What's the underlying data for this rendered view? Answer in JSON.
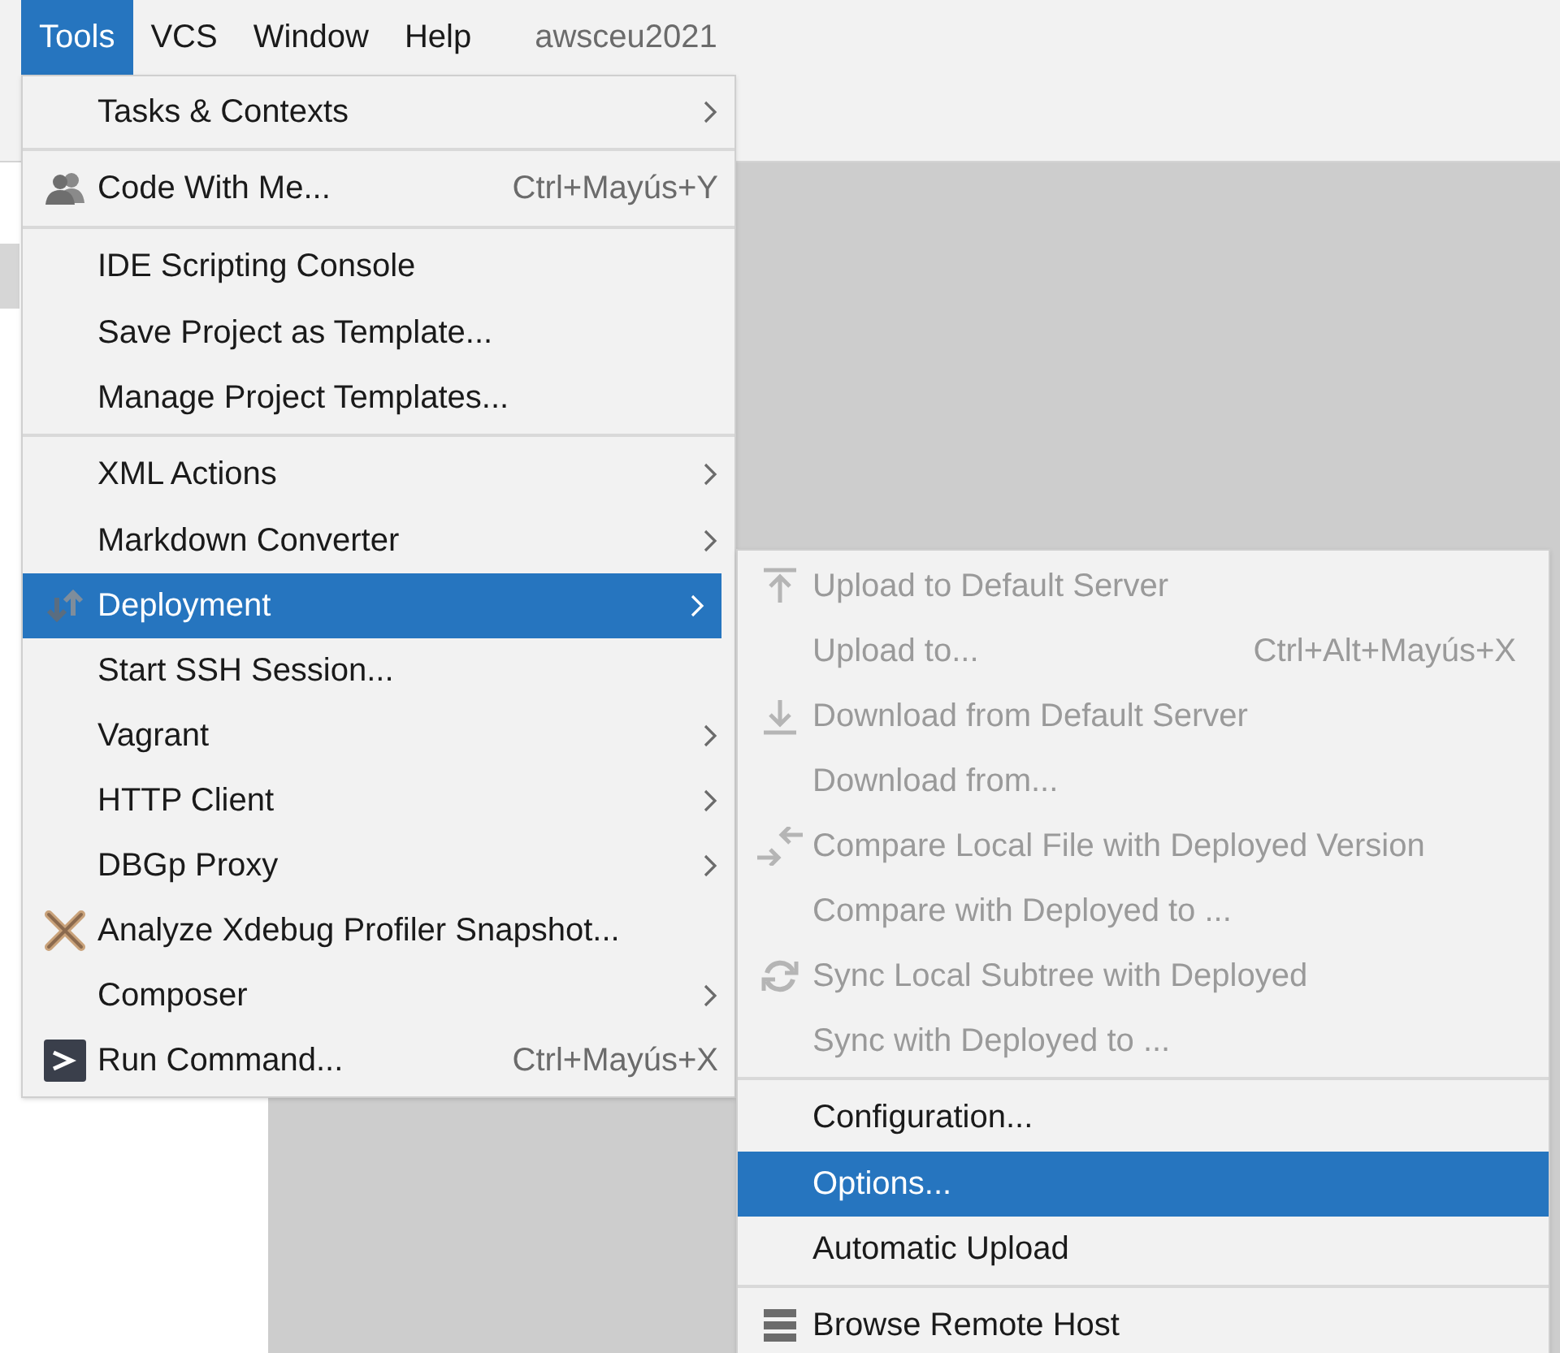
{
  "menu_bar": [
    {
      "label": "Tools",
      "selected": true
    },
    {
      "label": "VCS",
      "selected": false
    },
    {
      "label": "Window",
      "selected": false
    },
    {
      "label": "Help",
      "selected": false
    }
  ],
  "project_name": "awsceu2021",
  "tools_menu": [
    {
      "label": "Tasks & Contexts",
      "submenu": true,
      "selected": false,
      "separator_before": false
    },
    {
      "label": "Code With Me...",
      "shortcut": "Ctrl+Mayús+Y",
      "submenu": false,
      "selected": false,
      "separator_before": true
    },
    {
      "label": "IDE Scripting Console",
      "submenu": false,
      "selected": false,
      "separator_before": true
    },
    {
      "label": "Save Project as Template...",
      "submenu": false,
      "selected": false,
      "separator_before": false
    },
    {
      "label": "Manage Project Templates...",
      "submenu": false,
      "selected": false,
      "separator_before": false
    },
    {
      "label": "XML Actions",
      "submenu": true,
      "selected": false,
      "separator_before": true
    },
    {
      "label": "Markdown Converter",
      "submenu": true,
      "selected": false,
      "separator_before": false
    },
    {
      "label": "Deployment",
      "submenu": true,
      "selected": true,
      "separator_before": false
    },
    {
      "label": "Start SSH Session...",
      "submenu": false,
      "selected": false,
      "separator_before": false
    },
    {
      "label": "Vagrant",
      "submenu": true,
      "selected": false,
      "separator_before": false
    },
    {
      "label": "HTTP Client",
      "submenu": true,
      "selected": false,
      "separator_before": false
    },
    {
      "label": "DBGp Proxy",
      "submenu": true,
      "selected": false,
      "separator_before": false
    },
    {
      "label": "Analyze Xdebug Profiler Snapshot...",
      "submenu": false,
      "selected": false,
      "separator_before": false
    },
    {
      "label": "Composer",
      "submenu": true,
      "selected": false,
      "separator_before": false
    },
    {
      "label": "Run Command...",
      "shortcut": "Ctrl+Mayús+X",
      "submenu": false,
      "selected": false,
      "separator_before": false
    }
  ],
  "deployment_menu": [
    {
      "label": "Upload to Default Server",
      "disabled": true,
      "selected": false,
      "separator_before": false
    },
    {
      "label": "Upload to...",
      "shortcut": "Ctrl+Alt+Mayús+X",
      "disabled": true,
      "selected": false,
      "separator_before": false
    },
    {
      "label": "Download from Default Server",
      "disabled": true,
      "selected": false,
      "separator_before": false
    },
    {
      "label": "Download from...",
      "disabled": true,
      "selected": false,
      "separator_before": false
    },
    {
      "label": "Compare Local File with Deployed Version",
      "disabled": true,
      "selected": false,
      "separator_before": false
    },
    {
      "label": "Compare with Deployed to ...",
      "disabled": true,
      "selected": false,
      "separator_before": false
    },
    {
      "label": "Sync Local Subtree with Deployed",
      "disabled": true,
      "selected": false,
      "separator_before": false
    },
    {
      "label": "Sync with Deployed to ...",
      "disabled": true,
      "selected": false,
      "separator_before": false
    },
    {
      "label": "Configuration...",
      "disabled": false,
      "selected": false,
      "separator_before": true
    },
    {
      "label": "Options...",
      "disabled": false,
      "selected": true,
      "separator_before": false
    },
    {
      "label": "Automatic Upload",
      "disabled": false,
      "selected": false,
      "separator_before": false
    },
    {
      "label": "Browse Remote Host",
      "disabled": false,
      "selected": false,
      "separator_before": true
    }
  ]
}
